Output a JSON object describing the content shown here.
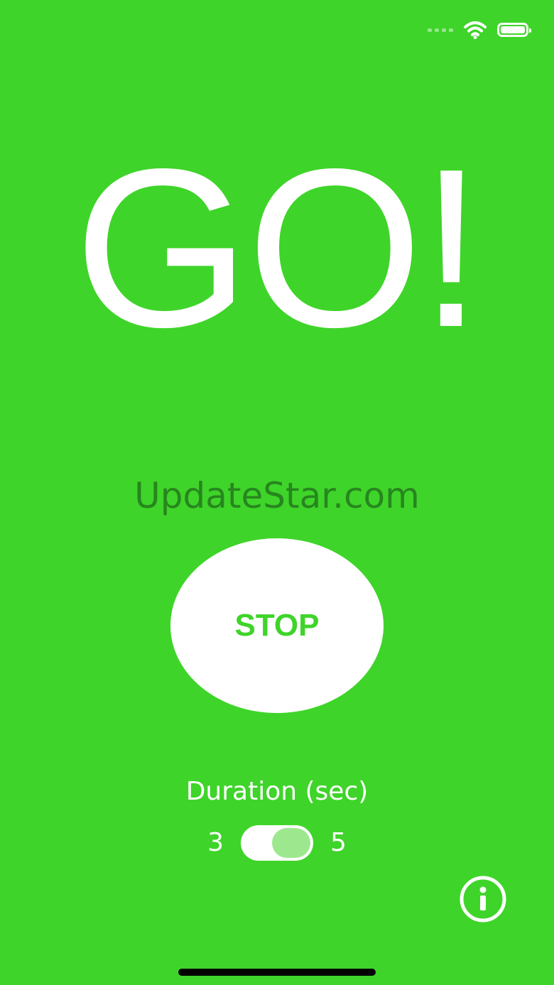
{
  "theme": {
    "background": "#3fd42a",
    "foreground": "#ffffff",
    "toggle_knob": "#9de88f"
  },
  "status_bar": {
    "icons": [
      "cellular-signal-icon",
      "wifi-icon",
      "battery-icon"
    ]
  },
  "main": {
    "headline": "GO!",
    "watermark": "UpdateStar.com",
    "stop_button_label": "STOP"
  },
  "duration": {
    "label": "Duration (sec)",
    "min_value": "3",
    "max_value": "5",
    "selected": "5"
  },
  "footer": {
    "info_icon": "info-icon"
  }
}
